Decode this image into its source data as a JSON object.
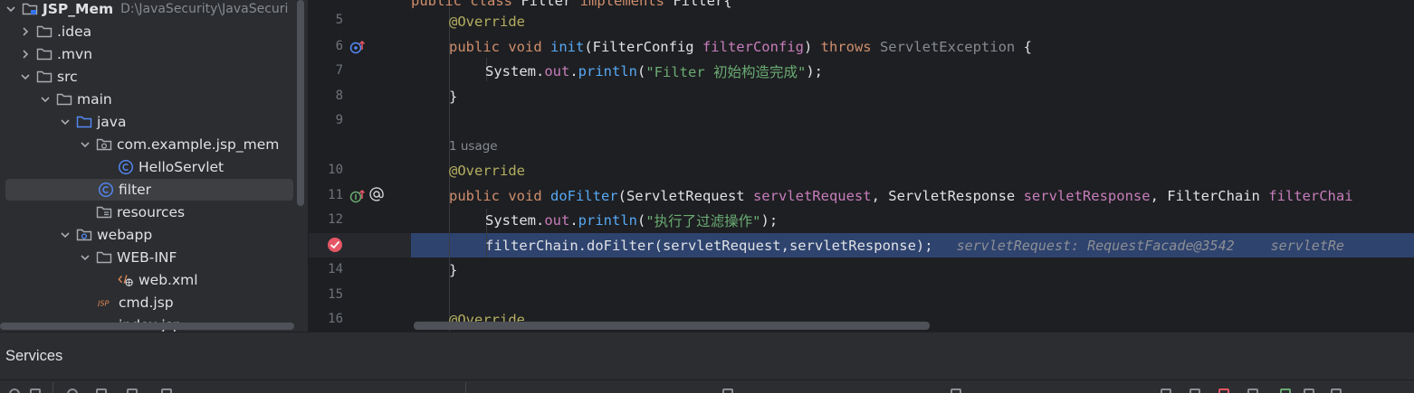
{
  "project": {
    "root": {
      "label": "JSP_Mem",
      "path": "D:\\JavaSecurity\\JavaSecuri"
    },
    "items": [
      {
        "label": ".idea"
      },
      {
        "label": ".mvn"
      },
      {
        "label": "src"
      },
      {
        "label": "main"
      },
      {
        "label": "java"
      },
      {
        "label": "com.example.jsp_mem"
      },
      {
        "label": "HelloServlet"
      },
      {
        "label": "filter"
      },
      {
        "label": "resources"
      },
      {
        "label": "webapp"
      },
      {
        "label": "WEB-INF"
      },
      {
        "label": "web.xml"
      },
      {
        "label": "cmd.jsp"
      },
      {
        "label": "index.jsp"
      }
    ]
  },
  "editor": {
    "line_numbers": {
      "l5": "5",
      "l6": "6",
      "l7": "7",
      "l8": "8",
      "l9": "9",
      "l10": "10",
      "l11": "11",
      "l12": "12",
      "l14": "14",
      "l15": "15",
      "l16": "16"
    },
    "usage_hint": "1 usage",
    "code": {
      "l4": {
        "a": "public class ",
        "b": "Filter",
        "c": " implements ",
        "d": "Filter{"
      },
      "l5": {
        "a": "@Override"
      },
      "l6": {
        "a": "public void ",
        "b": "init",
        "c": "(FilterConfig ",
        "d": "filterConfig",
        "e": ") ",
        "f": "throws ",
        "g": "ServletException",
        "h": " {"
      },
      "l7": {
        "a": "System.",
        "b": "out",
        "c": ".",
        "d": "println",
        "e": "(",
        "f": "\"Filter 初始构造完成\"",
        "g": ");"
      },
      "l8": {
        "a": "}"
      },
      "l10": {
        "a": "@Override"
      },
      "l11": {
        "a": "public void ",
        "b": "doFilter",
        "c": "(ServletRequest ",
        "d": "servletRequest",
        "e": ", ServletResponse ",
        "f": "servletResponse",
        "g": ", FilterChain ",
        "h": "filterChai"
      },
      "l12": {
        "a": "System.",
        "b": "out",
        "c": ".",
        "d": "println",
        "e": "(",
        "f": "\"执行了过滤操作\"",
        "g": ");"
      },
      "l13": {
        "a": "filterChain.doFilter(servletRequest,servletResponse);",
        "b": "servletRequest: RequestFacade@3542",
        "c": "servletRe"
      },
      "l14": {
        "a": "}"
      },
      "l16": {
        "a": "@Override"
      }
    }
  },
  "services": {
    "title": "Services"
  },
  "colors": {
    "panel_bg": "#2b2d30",
    "editor_bg": "#1e1f22",
    "execution_line": "#2e436e",
    "breakpoint": "#e55765",
    "keyword": "#cf8e6d",
    "annotation": "#b3ae60",
    "string": "#6aab73",
    "method": "#56a8f5"
  }
}
